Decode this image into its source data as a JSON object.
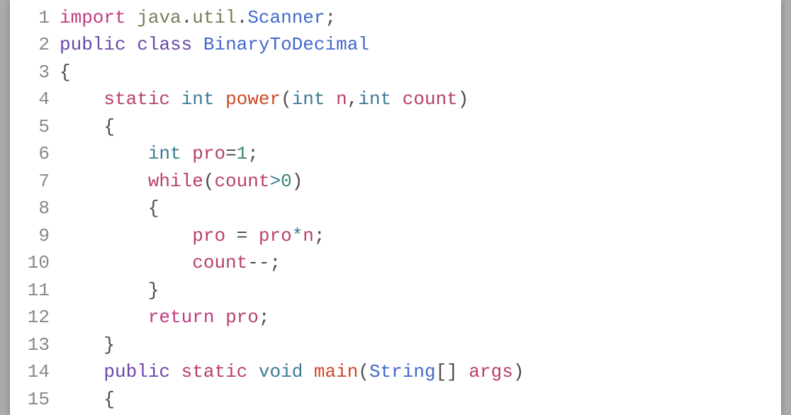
{
  "code": {
    "lines": [
      {
        "num": "1",
        "tokens": [
          {
            "text": "import",
            "class": "tok-keyword1"
          },
          {
            "text": " ",
            "class": ""
          },
          {
            "text": "java",
            "class": "tok-pkg"
          },
          {
            "text": ".",
            "class": "tok-punct"
          },
          {
            "text": "util",
            "class": "tok-pkg"
          },
          {
            "text": ".",
            "class": "tok-punct"
          },
          {
            "text": "Scanner",
            "class": "tok-classname"
          },
          {
            "text": ";",
            "class": "tok-punct"
          }
        ]
      },
      {
        "num": "2",
        "tokens": [
          {
            "text": "public",
            "class": "tok-keyword2"
          },
          {
            "text": " ",
            "class": ""
          },
          {
            "text": "class",
            "class": "tok-keyword2"
          },
          {
            "text": " ",
            "class": ""
          },
          {
            "text": "BinaryToDecimal",
            "class": "tok-classname"
          }
        ]
      },
      {
        "num": "3",
        "tokens": [
          {
            "text": "{",
            "class": "tok-punct"
          }
        ]
      },
      {
        "num": "4",
        "tokens": [
          {
            "text": "    ",
            "class": ""
          },
          {
            "text": "static",
            "class": "tok-keyword3"
          },
          {
            "text": " ",
            "class": ""
          },
          {
            "text": "int",
            "class": "tok-type"
          },
          {
            "text": " ",
            "class": ""
          },
          {
            "text": "power",
            "class": "tok-method"
          },
          {
            "text": "(",
            "class": "tok-punct"
          },
          {
            "text": "int",
            "class": "tok-type"
          },
          {
            "text": " ",
            "class": ""
          },
          {
            "text": "n",
            "class": "tok-var"
          },
          {
            "text": ",",
            "class": "tok-punct"
          },
          {
            "text": "int",
            "class": "tok-type"
          },
          {
            "text": " ",
            "class": ""
          },
          {
            "text": "count",
            "class": "tok-var"
          },
          {
            "text": ")",
            "class": "tok-punct"
          }
        ]
      },
      {
        "num": "5",
        "tokens": [
          {
            "text": "    {",
            "class": "tok-punct"
          }
        ]
      },
      {
        "num": "6",
        "tokens": [
          {
            "text": "        ",
            "class": ""
          },
          {
            "text": "int",
            "class": "tok-type"
          },
          {
            "text": " ",
            "class": ""
          },
          {
            "text": "pro",
            "class": "tok-var"
          },
          {
            "text": "=",
            "class": "tok-punct"
          },
          {
            "text": "1",
            "class": "tok-number"
          },
          {
            "text": ";",
            "class": "tok-punct"
          }
        ]
      },
      {
        "num": "7",
        "tokens": [
          {
            "text": "        ",
            "class": ""
          },
          {
            "text": "while",
            "class": "tok-keyword3"
          },
          {
            "text": "(",
            "class": "tok-punct"
          },
          {
            "text": "count",
            "class": "tok-var"
          },
          {
            "text": ">",
            "class": "tok-op"
          },
          {
            "text": "0",
            "class": "tok-number"
          },
          {
            "text": ")",
            "class": "tok-punct"
          }
        ]
      },
      {
        "num": "8",
        "tokens": [
          {
            "text": "        {",
            "class": "tok-punct"
          }
        ]
      },
      {
        "num": "9",
        "tokens": [
          {
            "text": "            ",
            "class": ""
          },
          {
            "text": "pro",
            "class": "tok-var"
          },
          {
            "text": " ",
            "class": ""
          },
          {
            "text": "=",
            "class": "tok-punct"
          },
          {
            "text": " ",
            "class": ""
          },
          {
            "text": "pro",
            "class": "tok-var"
          },
          {
            "text": "*",
            "class": "tok-op"
          },
          {
            "text": "n",
            "class": "tok-var"
          },
          {
            "text": ";",
            "class": "tok-punct"
          }
        ]
      },
      {
        "num": "10",
        "tokens": [
          {
            "text": "            ",
            "class": ""
          },
          {
            "text": "count",
            "class": "tok-var"
          },
          {
            "text": "--",
            "class": "tok-punct"
          },
          {
            "text": ";",
            "class": "tok-punct"
          }
        ]
      },
      {
        "num": "11",
        "tokens": [
          {
            "text": "        }",
            "class": "tok-punct"
          }
        ]
      },
      {
        "num": "12",
        "tokens": [
          {
            "text": "        ",
            "class": ""
          },
          {
            "text": "return",
            "class": "tok-keyword1"
          },
          {
            "text": " ",
            "class": ""
          },
          {
            "text": "pro",
            "class": "tok-var"
          },
          {
            "text": ";",
            "class": "tok-punct"
          }
        ]
      },
      {
        "num": "13",
        "tokens": [
          {
            "text": "    }",
            "class": "tok-punct"
          }
        ]
      },
      {
        "num": "14",
        "tokens": [
          {
            "text": "    ",
            "class": ""
          },
          {
            "text": "public",
            "class": "tok-keyword2"
          },
          {
            "text": " ",
            "class": ""
          },
          {
            "text": "static",
            "class": "tok-keyword3"
          },
          {
            "text": " ",
            "class": ""
          },
          {
            "text": "void",
            "class": "tok-type"
          },
          {
            "text": " ",
            "class": ""
          },
          {
            "text": "main",
            "class": "tok-method"
          },
          {
            "text": "(",
            "class": "tok-punct"
          },
          {
            "text": "String",
            "class": "tok-classname"
          },
          {
            "text": "[]",
            "class": "tok-punct"
          },
          {
            "text": " ",
            "class": ""
          },
          {
            "text": "args",
            "class": "tok-var"
          },
          {
            "text": ")",
            "class": "tok-punct"
          }
        ]
      },
      {
        "num": "15",
        "tokens": [
          {
            "text": "    {",
            "class": "tok-punct"
          }
        ]
      }
    ]
  }
}
